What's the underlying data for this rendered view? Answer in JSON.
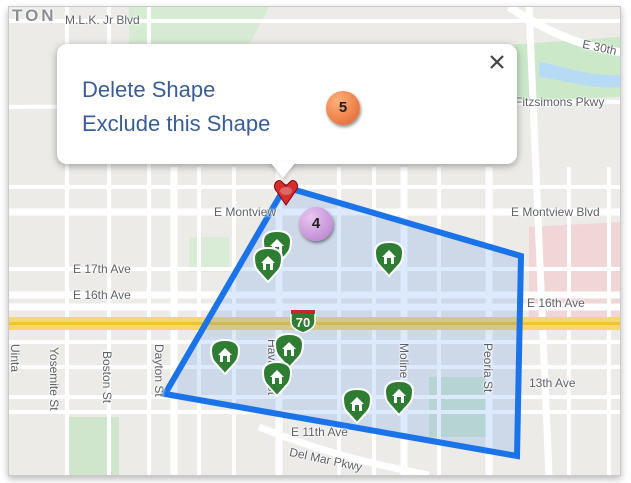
{
  "map": {
    "streets": {
      "district_partial": "TON",
      "mlk_blvd": "M.L.K. Jr Blvd",
      "e_30th": "E 30th",
      "fitzsimons": "Fitzsimons Pkwy",
      "e_montview_left": "E Montview",
      "e_montview_right": "E Montview Blvd",
      "e_17th": "E 17th Ave",
      "e_16th_left": "E 16th Ave",
      "e_16th_right": "E 16th Ave",
      "e_13th": "13th Ave",
      "e_11th": "E 11th Ave",
      "del_mar": "Del Mar Pkwy",
      "dayton": "Dayton St",
      "boston": "Boston St",
      "yosemite": "Yosemite St",
      "havana": "Havana St",
      "moline": "Moline St",
      "peoria": "Peoria St",
      "uinta_partial": "Uinta"
    },
    "interstate_shield": "70",
    "home_pins_icon": "home-pin-icon",
    "polygon_color": "#1a73e8",
    "polygon_fill": "rgba(66,133,244,0.18)"
  },
  "popup": {
    "actions": [
      "Delete Shape",
      "Exclude this Shape"
    ],
    "close_icon": "close-icon"
  },
  "annotations": {
    "step_4": "4",
    "step_5": "5"
  }
}
